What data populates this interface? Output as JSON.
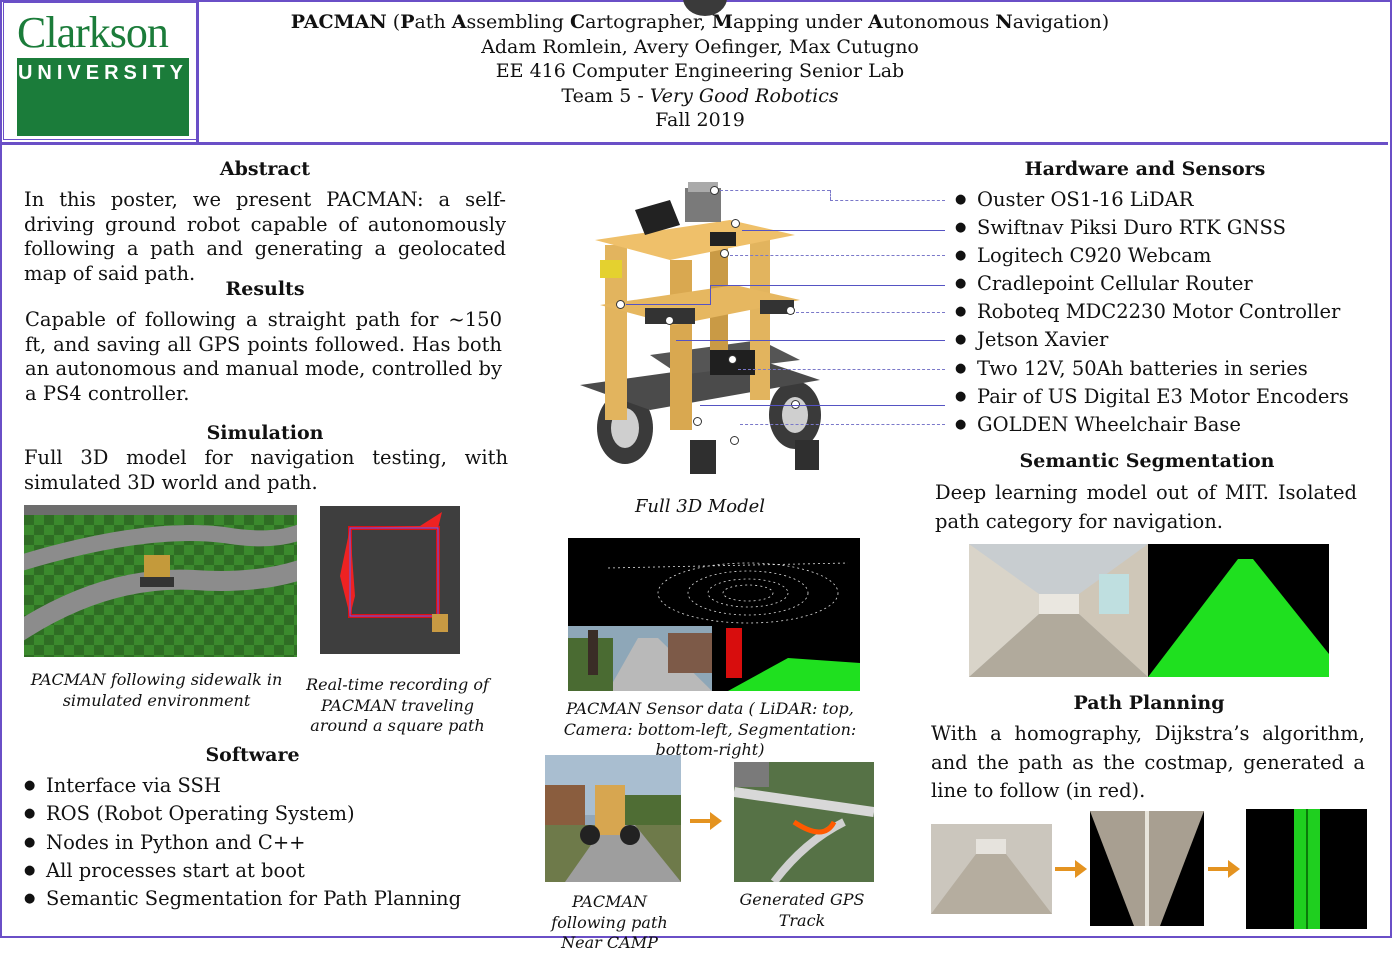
{
  "header": {
    "logo_top": "Clarkson",
    "logo_bottom": "UNIVERSITY",
    "title_bold": "PACMAN",
    "title_rest_html": "(<b>P</b>ath <b>A</b>ssembling <b>C</b>artographer, <b>M</b>apping under <b>A</b>utonomous <b>N</b>avigation)",
    "authors": "Adam Romlein, Avery Oefinger, Max Cutugno",
    "course": "EE 416 Computer Engineering Senior Lab",
    "team_prefix": "Team 5 - ",
    "team_name": "Very Good Robotics",
    "term": "Fall 2019"
  },
  "abstract": {
    "heading": "Abstract",
    "text": "In this poster, we present PACMAN: a self-driving ground robot capable of autonomously following a path and generating a geolocated map of said path."
  },
  "results": {
    "heading": "Results",
    "text": "Capable of following a straight path for ~150 ft, and saving all GPS points followed. Has both an autonomous and manual mode, controlled by a PS4 controller."
  },
  "simulation": {
    "heading": "Simulation",
    "text": "Full 3D model for navigation testing, with simulated 3D world and path.",
    "caption_left": "PACMAN following sidewalk  in simulated environment",
    "caption_right": "Real-time recording of PACMAN traveling around a square path"
  },
  "software": {
    "heading": "Software",
    "items": [
      "Interface via SSH",
      "ROS (Robot Operating System)",
      "Nodes in Python and C++",
      "All processes start at boot",
      "Semantic Segmentation for Path Planning"
    ]
  },
  "center": {
    "model_caption": "Full 3D Model",
    "sensor_caption": "PACMAN Sensor data ( LiDAR: top, Camera: bottom-left, Segmentation: bottom-right)",
    "camp_caption": "PACMAN following path Near CAMP",
    "gps_caption": "Generated GPS Track"
  },
  "hardware": {
    "heading": "Hardware and Sensors",
    "items": [
      "Ouster OS1-16 LiDAR",
      "Swiftnav Piksi Duro RTK GNSS",
      "Logitech C920 Webcam",
      "Cradlepoint Cellular Router",
      "Roboteq MDC2230 Motor Controller",
      "Jetson Xavier",
      "Two 12V, 50Ah batteries in series",
      "Pair of US Digital E3 Motor Encoders",
      "GOLDEN Wheelchair Base"
    ]
  },
  "segmentation": {
    "heading": "Semantic Segmentation",
    "text": "Deep learning model out of MIT. Isolated path category for navigation."
  },
  "planning": {
    "heading": "Path Planning",
    "text": "With a homography, Dijkstra’s algorithm, and the path as the costmap, generated a line to follow (in red)."
  },
  "colors": {
    "accent": "#6a4fc7",
    "brand_green": "#1b7c3a",
    "arrow": "#e49320",
    "seg_green": "#1fe01f"
  }
}
